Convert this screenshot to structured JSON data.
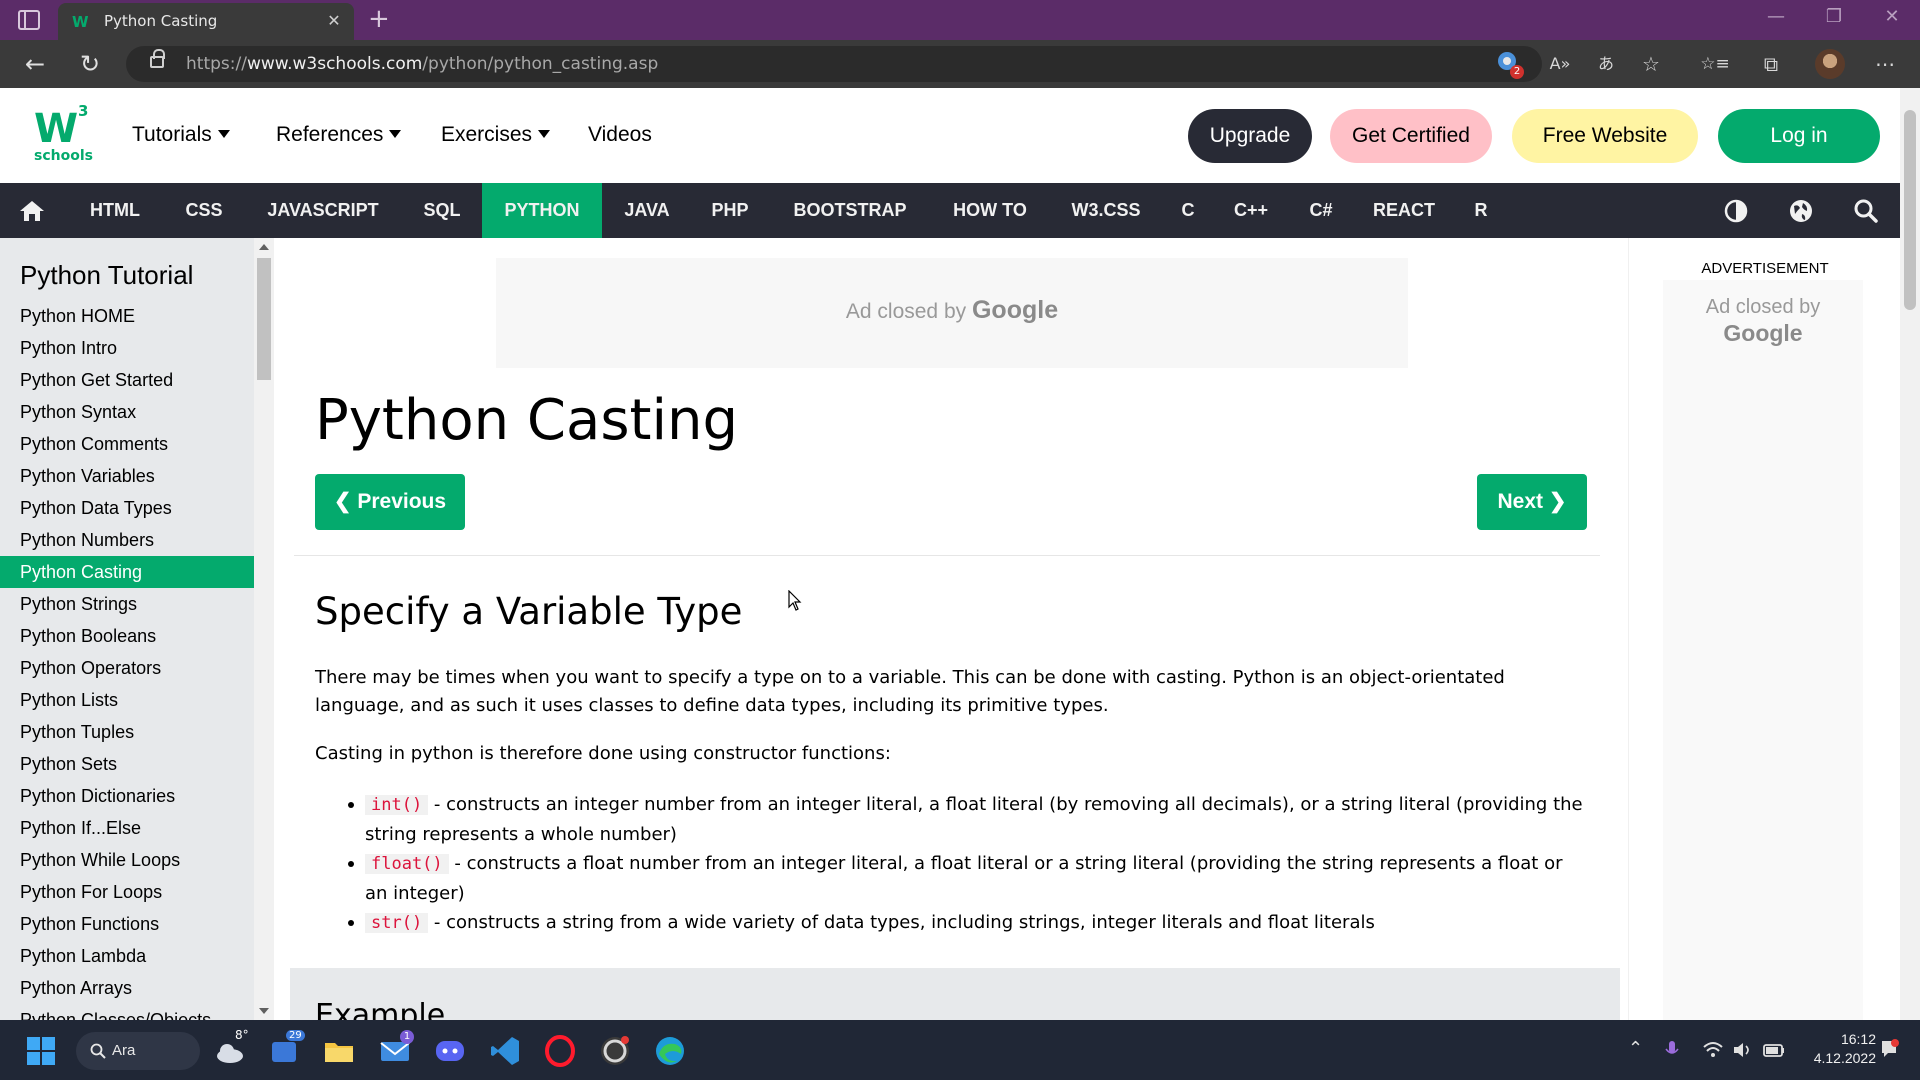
{
  "browser": {
    "tab_title": "Python Casting",
    "tab_close": "✕",
    "new_tab": "+",
    "url_scheme": "https://",
    "url_domain": "www.w3schools.com",
    "url_path": "/python/python_casting.asp",
    "extension_badge": "2",
    "back_icon": "←",
    "refresh_icon": "↻",
    "read_aloud_icon": "A»",
    "translate_icon": "あ",
    "favorite_icon": "☆",
    "favorites_icon": "☆≡",
    "collections_icon": "⧉",
    "more_icon": "⋯",
    "minimize": "—",
    "restore": "❐",
    "close": "✕"
  },
  "site_header": {
    "logo_w": "W",
    "logo_3": "3",
    "logo_schools": "schools",
    "menus": [
      "Tutorials",
      "References",
      "Exercises",
      "Videos"
    ],
    "upgrade": "Upgrade",
    "get_certified": "Get Certified",
    "free_website": "Free Website",
    "login": "Log in"
  },
  "topnav": {
    "items": [
      "HTML",
      "CSS",
      "JAVASCRIPT",
      "SQL",
      "PYTHON",
      "JAVA",
      "PHP",
      "BOOTSTRAP",
      "HOW TO",
      "W3.CSS",
      "C",
      "C++",
      "C#",
      "REACT",
      "R"
    ],
    "active": "PYTHON"
  },
  "sidebar": {
    "title": "Python Tutorial",
    "items": [
      "Python HOME",
      "Python Intro",
      "Python Get Started",
      "Python Syntax",
      "Python Comments",
      "Python Variables",
      "Python Data Types",
      "Python Numbers",
      "Python Casting",
      "Python Strings",
      "Python Booleans",
      "Python Operators",
      "Python Lists",
      "Python Tuples",
      "Python Sets",
      "Python Dictionaries",
      "Python If...Else",
      "Python While Loops",
      "Python For Loops",
      "Python Functions",
      "Python Lambda",
      "Python Arrays",
      "Python Classes/Objects"
    ],
    "active": "Python Casting"
  },
  "main": {
    "ad_closed_by": "Ad closed by",
    "ad_google": "Google",
    "title": "Python Casting",
    "previous": "❮ Previous",
    "next": "Next ❯",
    "h2": "Specify a Variable Type",
    "para1": "There may be times when you want to specify a type on to a variable. This can be done with casting. Python is an object-orientated language, and as such it uses classes to define data types, including its primitive types.",
    "para2": "Casting in python is therefore done using constructor functions:",
    "bullets": [
      {
        "code": "int()",
        "text": " - constructs an integer number from an integer literal, a float literal (by removing all decimals), or a string literal (providing the string represents a whole number)"
      },
      {
        "code": "float()",
        "text": " - constructs a float number from an integer literal, a float literal or a string literal (providing the string represents a float or an integer)"
      },
      {
        "code": "str()",
        "text": " - constructs a string from a wide variety of data types, including strings, integer literals and float literals"
      }
    ],
    "example_title": "Example"
  },
  "right": {
    "advertisement": "ADVERTISEMENT",
    "ad_closed_by": "Ad closed by",
    "ad_google": "Google"
  },
  "taskbar": {
    "search_label": "Ara",
    "weather_temp": "8°",
    "widgets_badge": "29",
    "mail_badge": "1",
    "date": "4.12.2022",
    "time": "16:12"
  },
  "colors": {
    "w3_green": "#04aa6d",
    "nav_dark": "#282a35",
    "sidebar_bg": "#e7e9eb",
    "code_red": "#dc143c",
    "titlebar": "#5b2c68",
    "upgrade_bg": "#282a35",
    "certified_bg": "#ffc0c7",
    "free_website_bg": "#fff4a3"
  }
}
